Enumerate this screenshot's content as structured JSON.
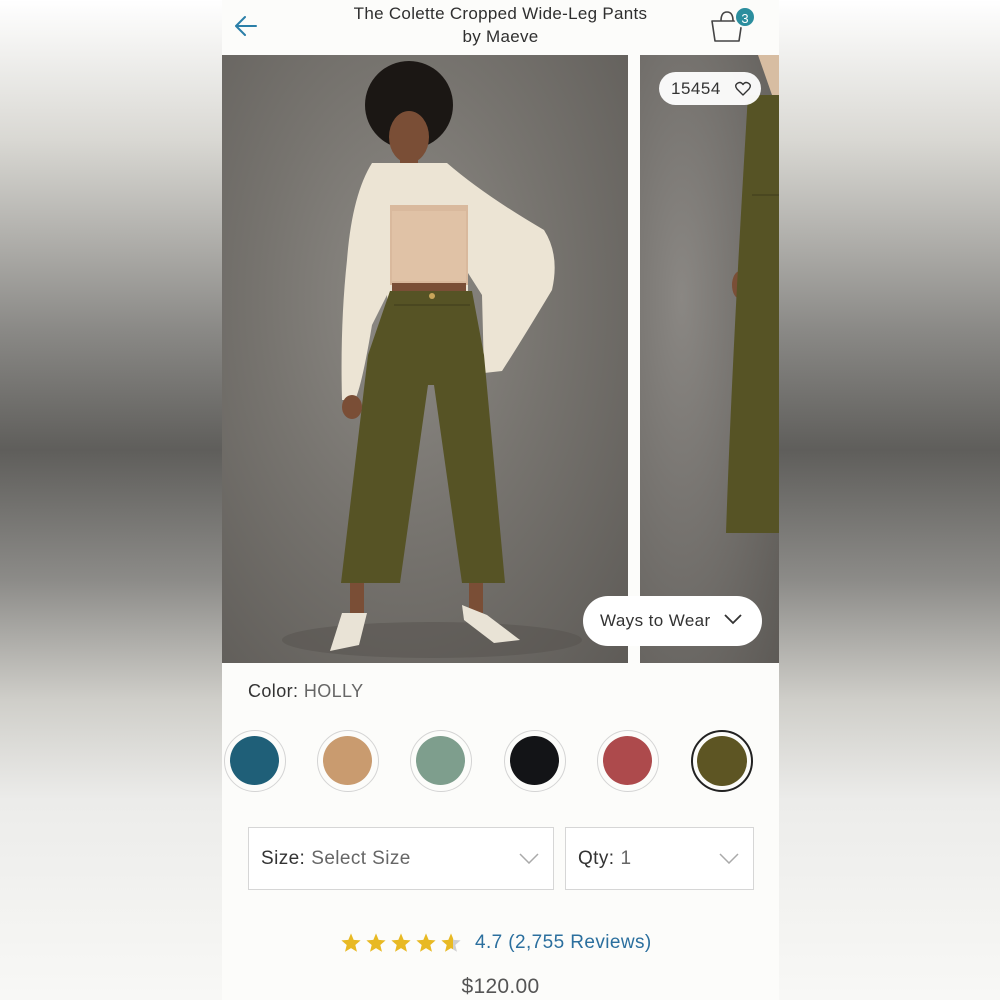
{
  "header": {
    "title_line1": "The Colette Cropped Wide-Leg Pants",
    "title_line2": "by Maeve",
    "bag_count": "3"
  },
  "gallery": {
    "likes_count": "15454",
    "ways_to_wear_label": "Ways to Wear"
  },
  "color": {
    "label": "Color:",
    "selected_name": "HOLLY",
    "swatches": [
      {
        "name": "teal",
        "hex": "#1f5f78"
      },
      {
        "name": "camel",
        "hex": "#c99b6f"
      },
      {
        "name": "sage",
        "hex": "#7e9e8d"
      },
      {
        "name": "black",
        "hex": "#131417"
      },
      {
        "name": "rose",
        "hex": "#ad4a4c"
      },
      {
        "name": "holly",
        "hex": "#5d5523"
      }
    ]
  },
  "size_select": {
    "label": "Size:",
    "value": "Select Size"
  },
  "qty_select": {
    "label": "Qty:",
    "value": "1"
  },
  "rating": {
    "stars": 4.7,
    "text": "4.7 (2,755 Reviews)"
  },
  "price": "$120.00",
  "colors": {
    "accent": "#2b8e9e",
    "link": "#2b6f9e",
    "star": "#e8b923"
  }
}
